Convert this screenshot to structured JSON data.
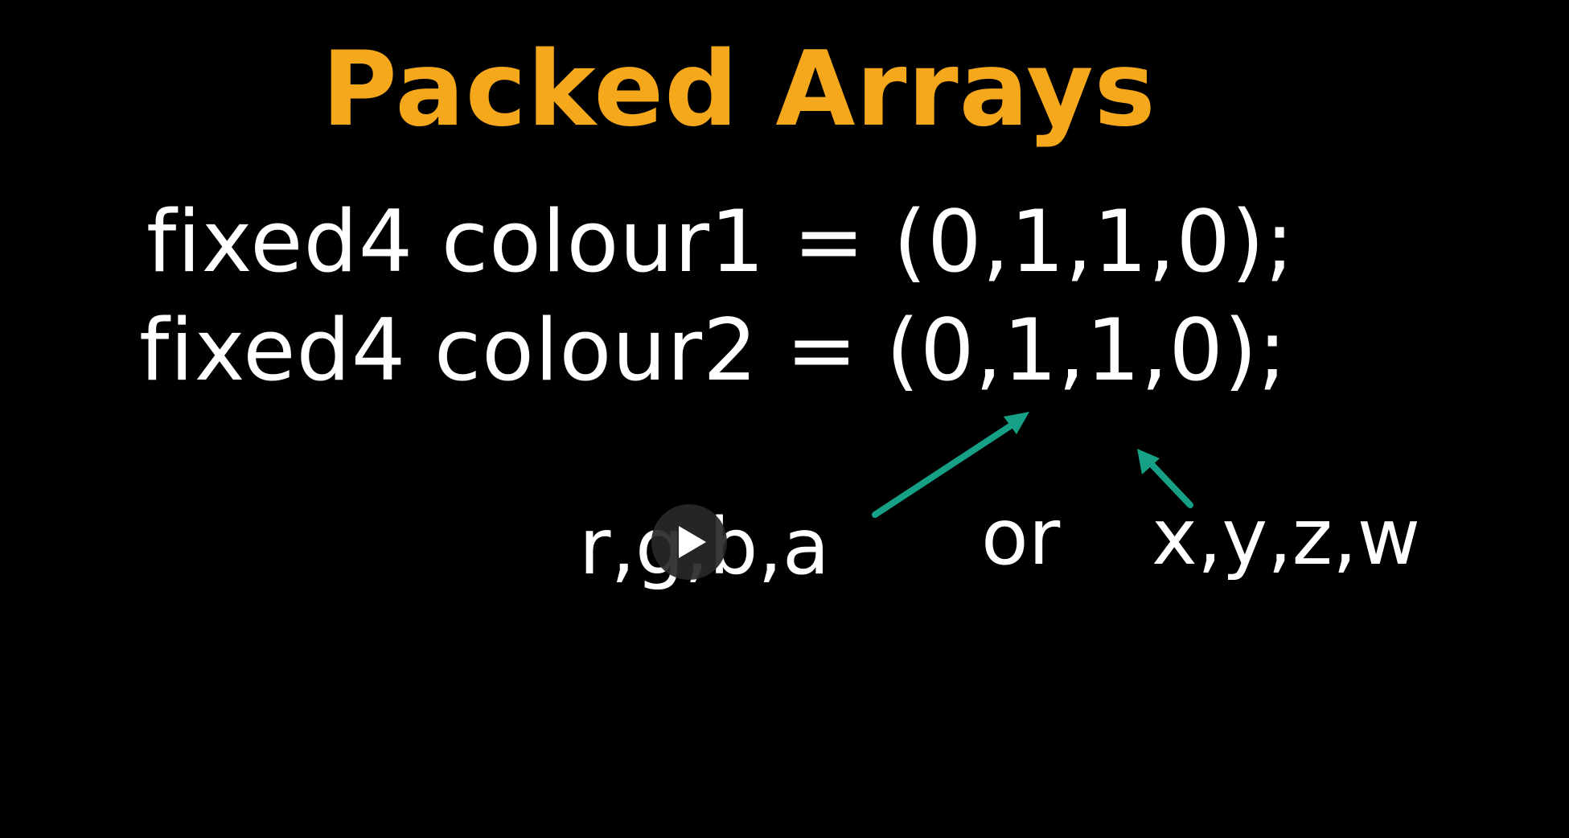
{
  "slide": {
    "title": "Packed Arrays",
    "code_lines": [
      "fixed4 colour1 = (0,1,1,0);",
      "fixed4 colour2 = (0,1,1,0);"
    ],
    "labels": {
      "rgba": "r,g,b,a",
      "or": "or",
      "xyzw": "x,y,z,w"
    }
  },
  "player": {
    "play_icon": "play-icon"
  },
  "colors": {
    "background": "#000000",
    "title": "#F5A81C",
    "text": "#FFFFFF",
    "arrow": "#16A085",
    "play_button": "#282828"
  }
}
